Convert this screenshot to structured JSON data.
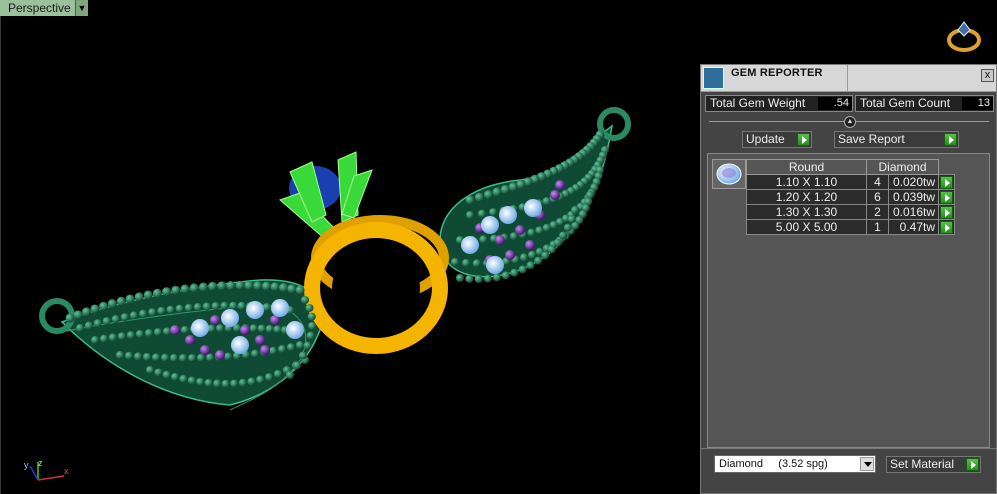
{
  "viewport": {
    "label": "Perspective",
    "menu_arrow": "▼",
    "axis": {
      "x": "x",
      "y": "y",
      "z": "z"
    }
  },
  "panel": {
    "title": "GEM REPORTER",
    "close": "x",
    "total_weight_label": "Total Gem Weight",
    "total_weight_value": ".54",
    "total_count_label": "Total Gem Count",
    "total_count_value": "13",
    "update_label": "Update",
    "save_label": "Save Report",
    "table": {
      "headers": [
        "Round",
        "Diamond"
      ],
      "rows": [
        {
          "size": "1.10 X 1.10",
          "count": "4",
          "weight": "0.020tw"
        },
        {
          "size": "1.20 X 1.20",
          "count": "6",
          "weight": "0.039tw"
        },
        {
          "size": "1.30 X 1.30",
          "count": "2",
          "weight": "0.016tw"
        },
        {
          "size": "5.00 X 5.00",
          "count": "1",
          "weight": "0.47tw"
        }
      ]
    },
    "material_select": "Diamond     (3.52 spg)",
    "set_material_label": "Set Material"
  },
  "colors": {
    "panel_bg": "#444444",
    "go_green": "#3fae34",
    "beads": "#1f6f4f",
    "gold": "#f0b000",
    "prongs": "#33dd33",
    "amethyst": "#7a2bb0",
    "diamond": "#a8d8ff"
  }
}
